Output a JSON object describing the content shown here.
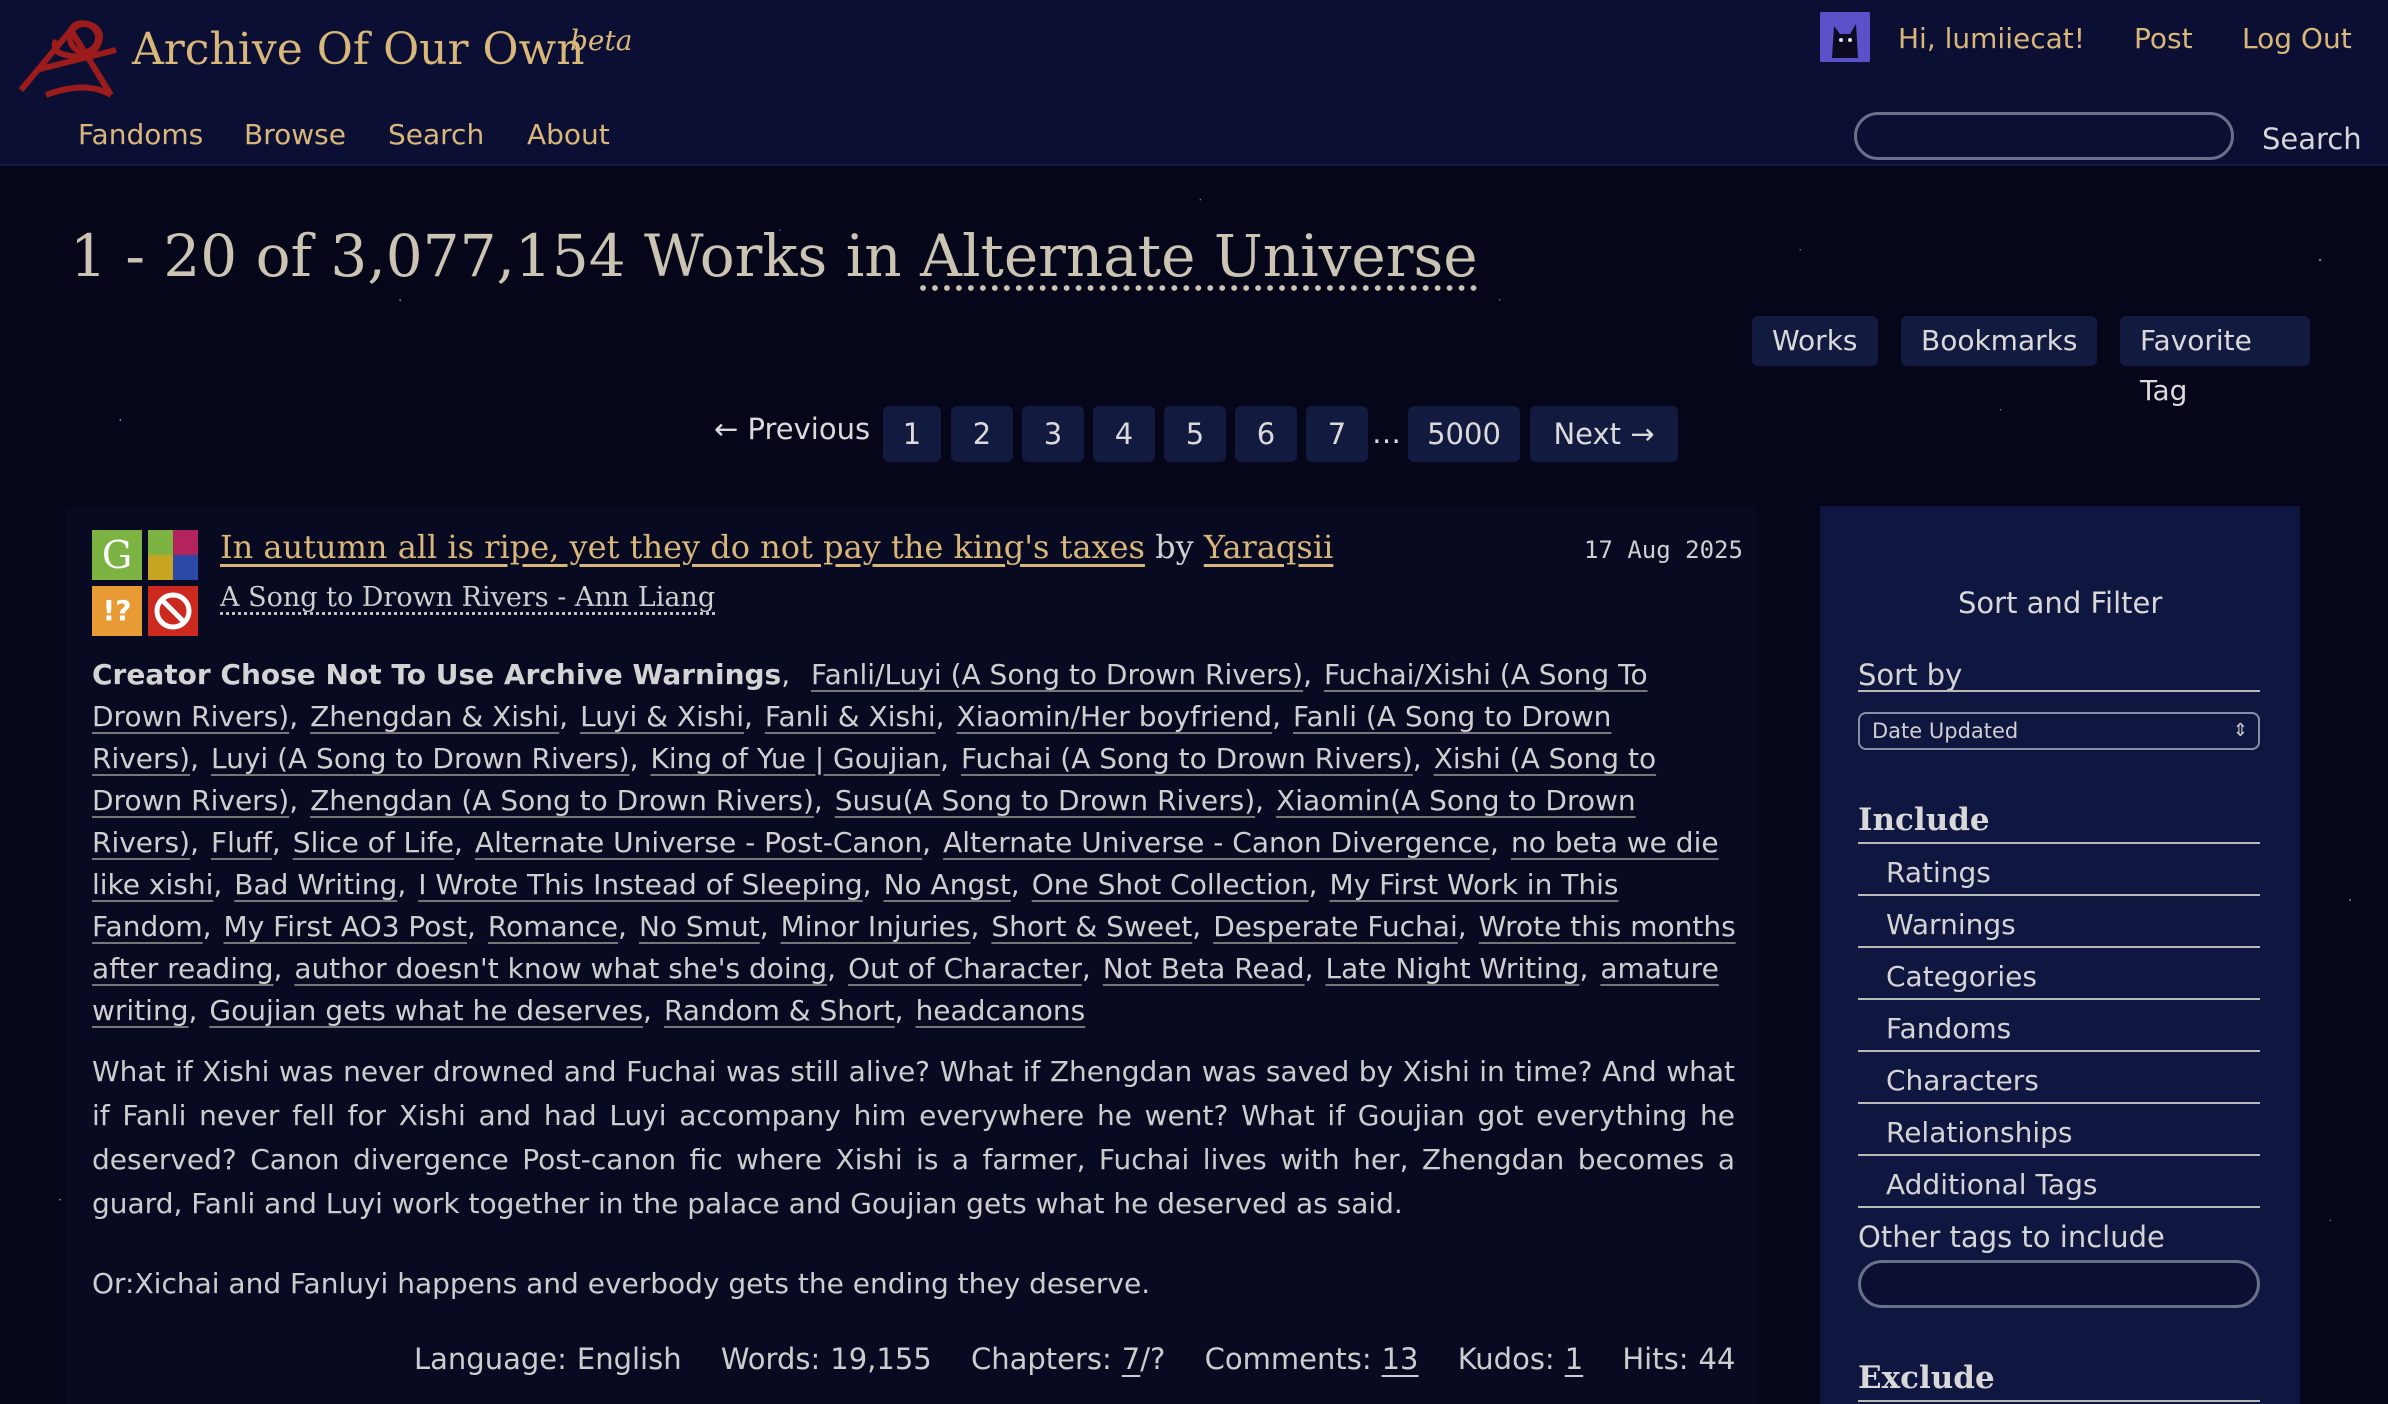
{
  "header": {
    "site_title": "Archive Of Our Own",
    "site_beta": "beta",
    "greeting": "Hi, lumiiecat!",
    "post_label": "Post",
    "logout_label": "Log Out",
    "nav": [
      "Fandoms",
      "Browse",
      "Search",
      "About"
    ],
    "search_button": "Search",
    "search_value": ""
  },
  "heading": {
    "prefix": "1 - 20 of 3,077,154 Works in",
    "tag": "Alternate Universe"
  },
  "tabs": [
    "Works",
    "Bookmarks",
    "Favorite Tag"
  ],
  "pagination": {
    "previous": "← Previous",
    "pages": [
      "1",
      "2",
      "3",
      "4",
      "5",
      "6",
      "7"
    ],
    "gap": "…",
    "last": "5000",
    "next": "Next →"
  },
  "work": {
    "title": "In autumn all is ripe, yet they do not pay the king's taxes",
    "by": "by",
    "author": "Yaraqsii",
    "fandom": "A Song to Drown Rivers - Ann Liang",
    "date": "17 Aug 2025",
    "required_tags": {
      "rating": "G",
      "warning": "!?",
      "colors": {
        "rating": "#7cb342",
        "warning": "#e89a35",
        "no_warning": "#cc2a1f"
      }
    },
    "warning_tag": "Creator Chose Not To Use Archive Warnings",
    "tags": [
      "Fanli/Luyi (A Song to Drown Rivers)",
      "Fuchai/Xishi (A Song To Drown Rivers)",
      "Zhengdan & Xishi",
      "Luyi & Xishi",
      "Fanli & Xishi",
      "Xiaomin/Her boyfriend",
      "Fanli (A Song to Drown Rivers)",
      "Luyi (A Song to Drown Rivers)",
      "King of Yue | Goujian",
      "Fuchai (A Song to Drown Rivers)",
      "Xishi (A Song to Drown Rivers)",
      "Zhengdan (A Song to Drown Rivers)",
      "Susu(A Song to Drown Rivers)",
      "Xiaomin(A Song to Drown Rivers)",
      "Fluff",
      "Slice of Life",
      "Alternate Universe - Post-Canon",
      "Alternate Universe - Canon Divergence",
      "no beta we die like xishi",
      "Bad Writing",
      "I Wrote This Instead of Sleeping",
      "No Angst",
      "One Shot Collection",
      "My First Work in This Fandom",
      "My First AO3 Post",
      "Romance",
      "No Smut",
      "Minor Injuries",
      "Short & Sweet",
      "Desperate Fuchai",
      "Wrote this months after reading",
      "author doesn't know what she's doing",
      "Out of Character",
      "Not Beta Read",
      "Late Night Writing",
      "amature writing",
      "Goujian gets what he deserves",
      "Random & Short",
      "headcanons"
    ],
    "summary_1": "What if Xishi was never drowned and Fuchai was still alive? What if Zhengdan was saved by Xishi in time? And what if Fanli never fell for Xishi and had Luyi accompany him everywhere he went? What if Goujian got everything he deserved? Canon divergence Post-canon fic where Xishi is a farmer, Fuchai lives with her, Zhengdan becomes a guard, Fanli and Luyi work together in the palace and Goujian gets what he deserved as said.",
    "summary_2": "Or:Xichai and Fanluyi happens and everbody gets the ending they deserve.",
    "stats": {
      "language_label": "Language:",
      "language": "English",
      "words_label": "Words:",
      "words": "19,155",
      "chapters_label": "Chapters:",
      "chapters_current": "7",
      "chapters_total": "/?",
      "comments_label": "Comments:",
      "comments": "13",
      "kudos_label": "Kudos:",
      "kudos": "1",
      "hits_label": "Hits:",
      "hits": "44"
    }
  },
  "filters": {
    "heading": "Sort and Filter",
    "sort_by_label": "Sort by",
    "sort_value": "Date Updated",
    "include_label": "Include",
    "include_items": [
      "Ratings",
      "Warnings",
      "Categories",
      "Fandoms",
      "Characters",
      "Relationships",
      "Additional Tags"
    ],
    "other_tags_label": "Other tags to include",
    "other_tags_value": "",
    "exclude_label": "Exclude"
  },
  "colors": {
    "link": "#d9b679",
    "header_bg": "#0b0f33",
    "panel_bg": "#0f1640",
    "button_bg": "#131a3f"
  }
}
